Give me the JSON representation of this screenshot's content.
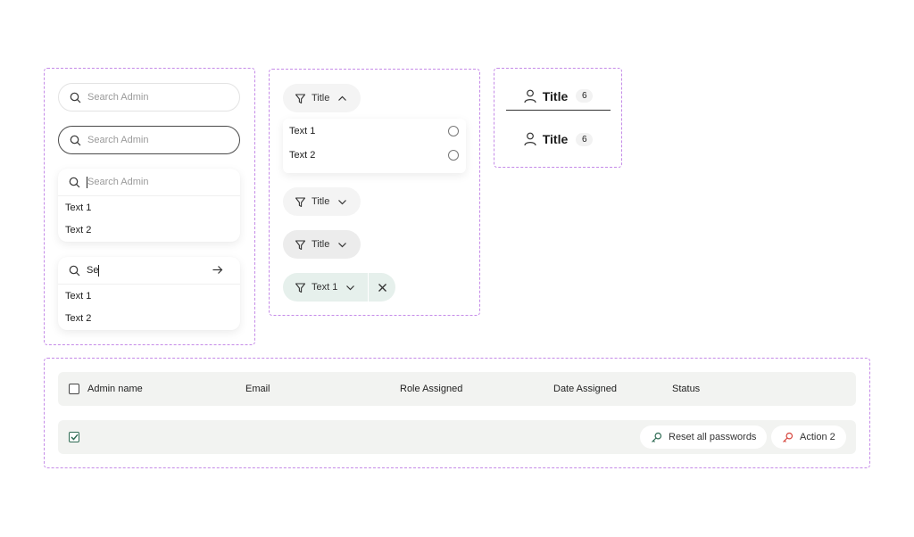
{
  "search": {
    "placeholder": "Search Admin",
    "typed_value": "Se",
    "results_a": [
      "Text 1",
      "Text 2"
    ],
    "results_b": [
      "Text 1",
      "Text 2"
    ]
  },
  "filter": {
    "chip_title": "Title",
    "options": [
      {
        "label": "Text 1",
        "selected": false
      },
      {
        "label": "Text 2",
        "selected": false
      }
    ],
    "active_label": "Text 1"
  },
  "tabs": [
    {
      "label": "Title",
      "count": "6",
      "selected": true
    },
    {
      "label": "Title",
      "count": "6",
      "selected": false
    }
  ],
  "table": {
    "columns": [
      "Admin name",
      "Email",
      "Role Assigned",
      "Date Assigned",
      "Status"
    ],
    "row_checked": true,
    "actions": [
      {
        "label": "Reset all passwords",
        "icon": "key-icon",
        "color": "#2f6b54"
      },
      {
        "label": "Action 2",
        "icon": "key-icon",
        "color": "#d6453d"
      }
    ]
  },
  "colors": {
    "frame_border": "#c58be8",
    "accent_green": "#2f6b54",
    "accent_red": "#d6453d",
    "chip_active_bg": "#e6f0ec"
  }
}
